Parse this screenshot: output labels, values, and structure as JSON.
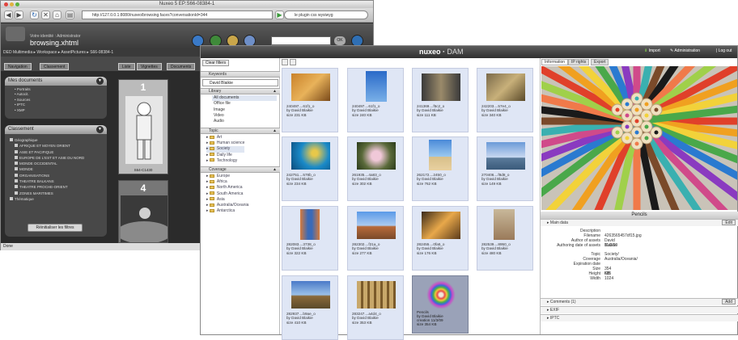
{
  "back_window": {
    "title": "Nuxeo 5 EP:S66-08384-1",
    "url": "http://127.0.0.1:8080/nuxeo/browsing.faces?conversationId=344",
    "search_query": "le plugin css wysiwyg",
    "user_line": "Votre identité : Administrator",
    "page_name": "browsing.xhtml",
    "ok_label": "OK",
    "breadcrumb": "DED Multimedia ▸ Workspace ▸ AssetPictures ▸ S66-08384-1",
    "tabs": [
      "Navigation",
      "Classement"
    ],
    "view_buttons": [
      "Liste",
      "Vignettes",
      "Documents"
    ],
    "panel1": {
      "title": "Mes documents",
      "items": [
        "Portraits",
        "Autocit.",
        "Sources",
        "IPTC",
        "XMP"
      ]
    },
    "panel2": {
      "title": "Classement",
      "root": "Géographique",
      "items": [
        "AFRIQUE ET MOYEN ORIENT",
        "ASIE ET PACIFIQUE",
        "EUROPE DE L'EST ET ASIE DU NORD",
        "MONDE OCCIDENTAL",
        "MONDE",
        "ORGANISATIONS",
        "THEATRE BALKANS",
        "THEATRE PROCHE-ORIENT",
        "ZONES MARITIMES"
      ],
      "second_root": "Thématique"
    },
    "reset_label": "Réinitialiser les filtres",
    "thumbs": [
      {
        "num": "1",
        "caption": "S64-C1430"
      },
      {
        "num": "4",
        "caption": ""
      }
    ],
    "status": "Done"
  },
  "front_window": {
    "brand": "nuxeo",
    "brand_suffix": "DAM",
    "import_label": "Import",
    "admin_label": "Administration",
    "logout_label": "Log out",
    "clear_filters": "Clear filters",
    "keywords_title": "Keywords",
    "keyword_value": "David Blaikie",
    "library_title": "Library",
    "library_items": [
      "All documents",
      "Office file",
      "Image",
      "Video",
      "Audio"
    ],
    "topic_title": "Topic",
    "topics": [
      "Art",
      "Human science",
      "Society",
      "Daily life",
      "Technology"
    ],
    "coverage_title": "Coverage",
    "coverage": [
      "Europe",
      "Africa",
      "North America",
      "South America",
      "Asia",
      "Australia/Oceania",
      "Antarctica"
    ],
    "grid": [
      {
        "name": "240497....61f1_o",
        "author": "by David Blaikie",
        "size": "size 231 KB"
      },
      {
        "name": "240497....61f1_o",
        "author": "by David Blaikie",
        "size": "size 240 KB"
      },
      {
        "name": "241369....f5c2_o",
        "author": "by David Blaikie",
        "size": "size 111 KB"
      },
      {
        "name": "242203....57e4_o",
        "author": "by David Blaikie",
        "size": "size 340 KB"
      },
      {
        "name": "242751....578b_o",
        "author": "by David Blaikie",
        "size": "size 234 KB"
      },
      {
        "name": "261935....4a83_o",
        "author": "by David Blaikie",
        "size": "size 302 KB"
      },
      {
        "name": "262172....2450_o",
        "author": "by David Blaikie",
        "size": "size 762 KB"
      },
      {
        "name": "270406....f8d8_o",
        "author": "by David Blaikie",
        "size": "size 149 KB"
      },
      {
        "name": "282083....3738_o",
        "author": "by David Blaikie",
        "size": "size 322 KB"
      },
      {
        "name": "282302....f21a_o",
        "author": "by David Blaikie",
        "size": "size 277 KB"
      },
      {
        "name": "282455....0fa5_o",
        "author": "by David Blaikie",
        "size": "size 176 KB"
      },
      {
        "name": "282539....8950_o",
        "author": "by David Blaikie",
        "size": "size 480 KB"
      },
      {
        "name": "282937....b9ae_o",
        "author": "by David Blaikie",
        "size": "size 410 KB"
      },
      {
        "name": "283247....a4d4_o",
        "author": "by David Blaikie",
        "size": "size 353 KB"
      },
      {
        "name": "Pencils",
        "author": "by David Blaikie",
        "size": "creation 11/3/09",
        "extra": "size 354 KB"
      }
    ],
    "right_tabs": [
      "Information",
      "IP rights",
      "Export"
    ],
    "preview_title": "Pencils",
    "main_data_label": "Main data",
    "edit_label": "Edit",
    "metadata": [
      {
        "k": "Description",
        "v": ""
      },
      {
        "k": "Filename",
        "v": "4263565457df15.jpg"
      },
      {
        "k": "Author of assets",
        "v": "David Blaikie"
      },
      {
        "k": "Authoring date of assets",
        "v": "11/3/09"
      },
      {
        "k": "Topic",
        "v": "Society/"
      },
      {
        "k": "Coverage",
        "v": "Australia/Oceania/"
      },
      {
        "k": "Expiration date",
        "v": ""
      },
      {
        "k": "Size",
        "v": "354 KB"
      },
      {
        "k": "Height",
        "v": "685"
      },
      {
        "k": "Width",
        "v": "1024"
      }
    ],
    "comments_label": "Comments (1)",
    "add_label": "Add",
    "exif_label": "EXIF",
    "iptc_label": "IPTC"
  }
}
